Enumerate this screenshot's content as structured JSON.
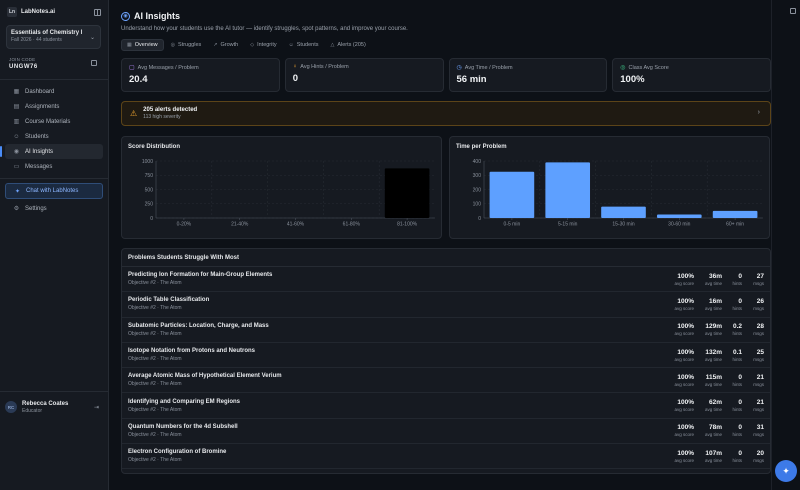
{
  "app": {
    "name": "LabNotes.ai",
    "logo_text": "Ln"
  },
  "course": {
    "name": "Essentials of Chemistry I",
    "sub": "Fall 2026 · 44 students"
  },
  "join": {
    "label": "JOIN CODE",
    "code": "UNGW76"
  },
  "nav": [
    {
      "label": "Dashboard",
      "icon": "grid-icon",
      "glyph": "▦",
      "active": false
    },
    {
      "label": "Assignments",
      "icon": "clipboard-icon",
      "glyph": "▤",
      "active": false
    },
    {
      "label": "Course Materials",
      "icon": "book-icon",
      "glyph": "▥",
      "active": false
    },
    {
      "label": "Students",
      "icon": "users-icon",
      "glyph": "☺",
      "active": false
    },
    {
      "label": "AI Insights",
      "icon": "insight-icon",
      "glyph": "◉",
      "active": true
    },
    {
      "label": "Messages",
      "icon": "message-icon",
      "glyph": "▭",
      "active": false
    }
  ],
  "nav_bottom": [
    {
      "label": "Chat with LabNotes",
      "icon": "sparkle-icon",
      "glyph": "✦"
    },
    {
      "label": "Settings",
      "icon": "gear-icon",
      "glyph": "⚙"
    }
  ],
  "user": {
    "initials": "RC",
    "name": "Rebecca Coates",
    "role": "Educator"
  },
  "page": {
    "title": "AI Insights",
    "subtitle": "Understand how your students use the AI tutor — identify struggles, spot patterns, and improve your course."
  },
  "tabs": [
    {
      "label": "Overview",
      "glyph": "▦",
      "active": true
    },
    {
      "label": "Struggles",
      "glyph": "◎",
      "active": false
    },
    {
      "label": "Growth",
      "glyph": "↗",
      "active": false
    },
    {
      "label": "Integrity",
      "glyph": "◇",
      "active": false
    },
    {
      "label": "Students",
      "glyph": "☺",
      "active": false
    },
    {
      "label": "Alerts (205)",
      "glyph": "△",
      "active": false
    }
  ],
  "stats": [
    {
      "label": "Avg Messages / Problem",
      "value": "20.4",
      "glyph": "▢",
      "color": "#b085f5"
    },
    {
      "label": "Avg Hints / Problem",
      "value": "0",
      "glyph": "♀",
      "color": "#f0a530"
    },
    {
      "label": "Avg Time / Problem",
      "value": "56 min",
      "glyph": "◷",
      "color": "#6ea4ff"
    },
    {
      "label": "Class Avg Score",
      "value": "100%",
      "glyph": "◎",
      "color": "#3ecf8e"
    }
  ],
  "alert": {
    "title": "205 alerts detected",
    "sub": "113 high severity"
  },
  "chart_data": [
    {
      "type": "bar",
      "title": "Score Distribution",
      "categories": [
        "0-20%",
        "21-40%",
        "41-60%",
        "61-80%",
        "81-100%"
      ],
      "values": [
        0,
        0,
        0,
        0,
        870
      ],
      "yticks": [
        0,
        250,
        500,
        750,
        1000
      ],
      "ylim": [
        0,
        1000
      ],
      "bar_color": "#000000",
      "grid": true
    },
    {
      "type": "bar",
      "title": "Time per Problem",
      "categories": [
        "0-5 min",
        "5-15 min",
        "15-30 min",
        "30-60 min",
        "60+ min"
      ],
      "values": [
        325,
        390,
        80,
        25,
        50
      ],
      "yticks": [
        0,
        100,
        200,
        300,
        400
      ],
      "ylim": [
        0,
        400
      ],
      "bar_color": "#5ea0ff",
      "grid": true
    }
  ],
  "table": {
    "title": "Problems Students Struggle With Most",
    "labels": {
      "score": "avg score",
      "time": "avg time",
      "hints": "hints",
      "msgs": "msgs"
    },
    "rows": [
      {
        "title": "Predicting Ion Formation for Main-Group Elements",
        "sub": "Objective #2 · The Atom",
        "score": "100%",
        "time": "36m",
        "hints": "0",
        "msgs": "27"
      },
      {
        "title": "Periodic Table Classification",
        "sub": "Objective #2 · The Atom",
        "score": "100%",
        "time": "16m",
        "hints": "0",
        "msgs": "26"
      },
      {
        "title": "Subatomic Particles: Location, Charge, and Mass",
        "sub": "Objective #2 · The Atom",
        "score": "100%",
        "time": "129m",
        "hints": "0.2",
        "msgs": "28"
      },
      {
        "title": "Isotope Notation from Protons and Neutrons",
        "sub": "Objective #2 · The Atom",
        "score": "100%",
        "time": "132m",
        "hints": "0.1",
        "msgs": "25"
      },
      {
        "title": "Average Atomic Mass of Hypothetical Element Verium",
        "sub": "Objective #2 · The Atom",
        "score": "100%",
        "time": "115m",
        "hints": "0",
        "msgs": "21"
      },
      {
        "title": "Identifying and Comparing EM Regions",
        "sub": "Objective #2 · The Atom",
        "score": "100%",
        "time": "62m",
        "hints": "0",
        "msgs": "21"
      },
      {
        "title": "Quantum Numbers for the 4d Subshell",
        "sub": "Objective #2 · The Atom",
        "score": "100%",
        "time": "78m",
        "hints": "0",
        "msgs": "31"
      },
      {
        "title": "Electron Configuration of Bromine",
        "sub": "Objective #2 · The Atom",
        "score": "100%",
        "time": "107m",
        "hints": "0",
        "msgs": "20"
      }
    ]
  }
}
